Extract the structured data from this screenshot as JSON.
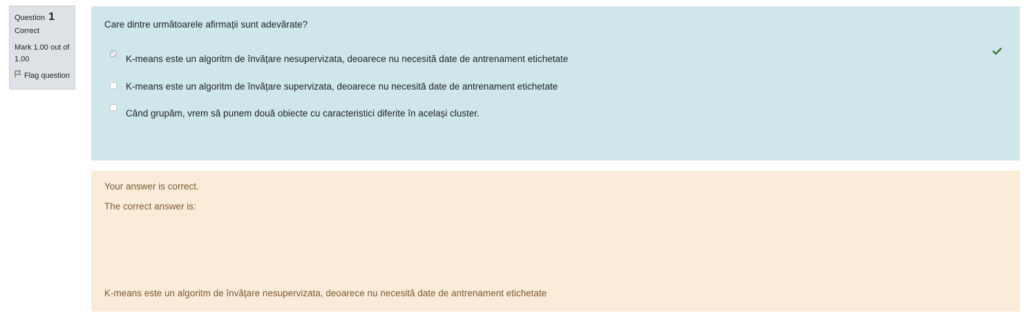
{
  "info": {
    "question_label": "Question",
    "question_number": "1",
    "state": "Correct",
    "grade": "Mark 1.00 out of 1.00",
    "flag_label": "Flag question"
  },
  "question": {
    "text": "Care dintre următoarele afirmații sunt adevărate?",
    "options": [
      {
        "label": "K-means este un algoritm de învățare nesupervizata, deoarece nu necesită date de antrenament etichetate",
        "checked": true
      },
      {
        "label": "K-means este un algoritm de învățare supervizata, deoarece nu necesită date de antrenament etichetate",
        "checked": false
      },
      {
        "label": "Când grupăm, vrem să punem două obiecte cu caracteristici diferite în același cluster.",
        "checked": false
      }
    ],
    "correct_icon": "check-icon"
  },
  "outcome": {
    "feedback": "Your answer is correct.",
    "right_answer_label": "The correct answer is:",
    "right_answer": "K-means este un algoritm de învățare nesupervizata, deoarece nu necesită date de antrenament etichetate"
  },
  "colors": {
    "formulation_bg": "#cfe6ea",
    "outcome_bg": "#fbecd9",
    "outcome_text": "#7a5a35",
    "info_bg": "#dee2e6",
    "correct_green": "#357a32"
  }
}
